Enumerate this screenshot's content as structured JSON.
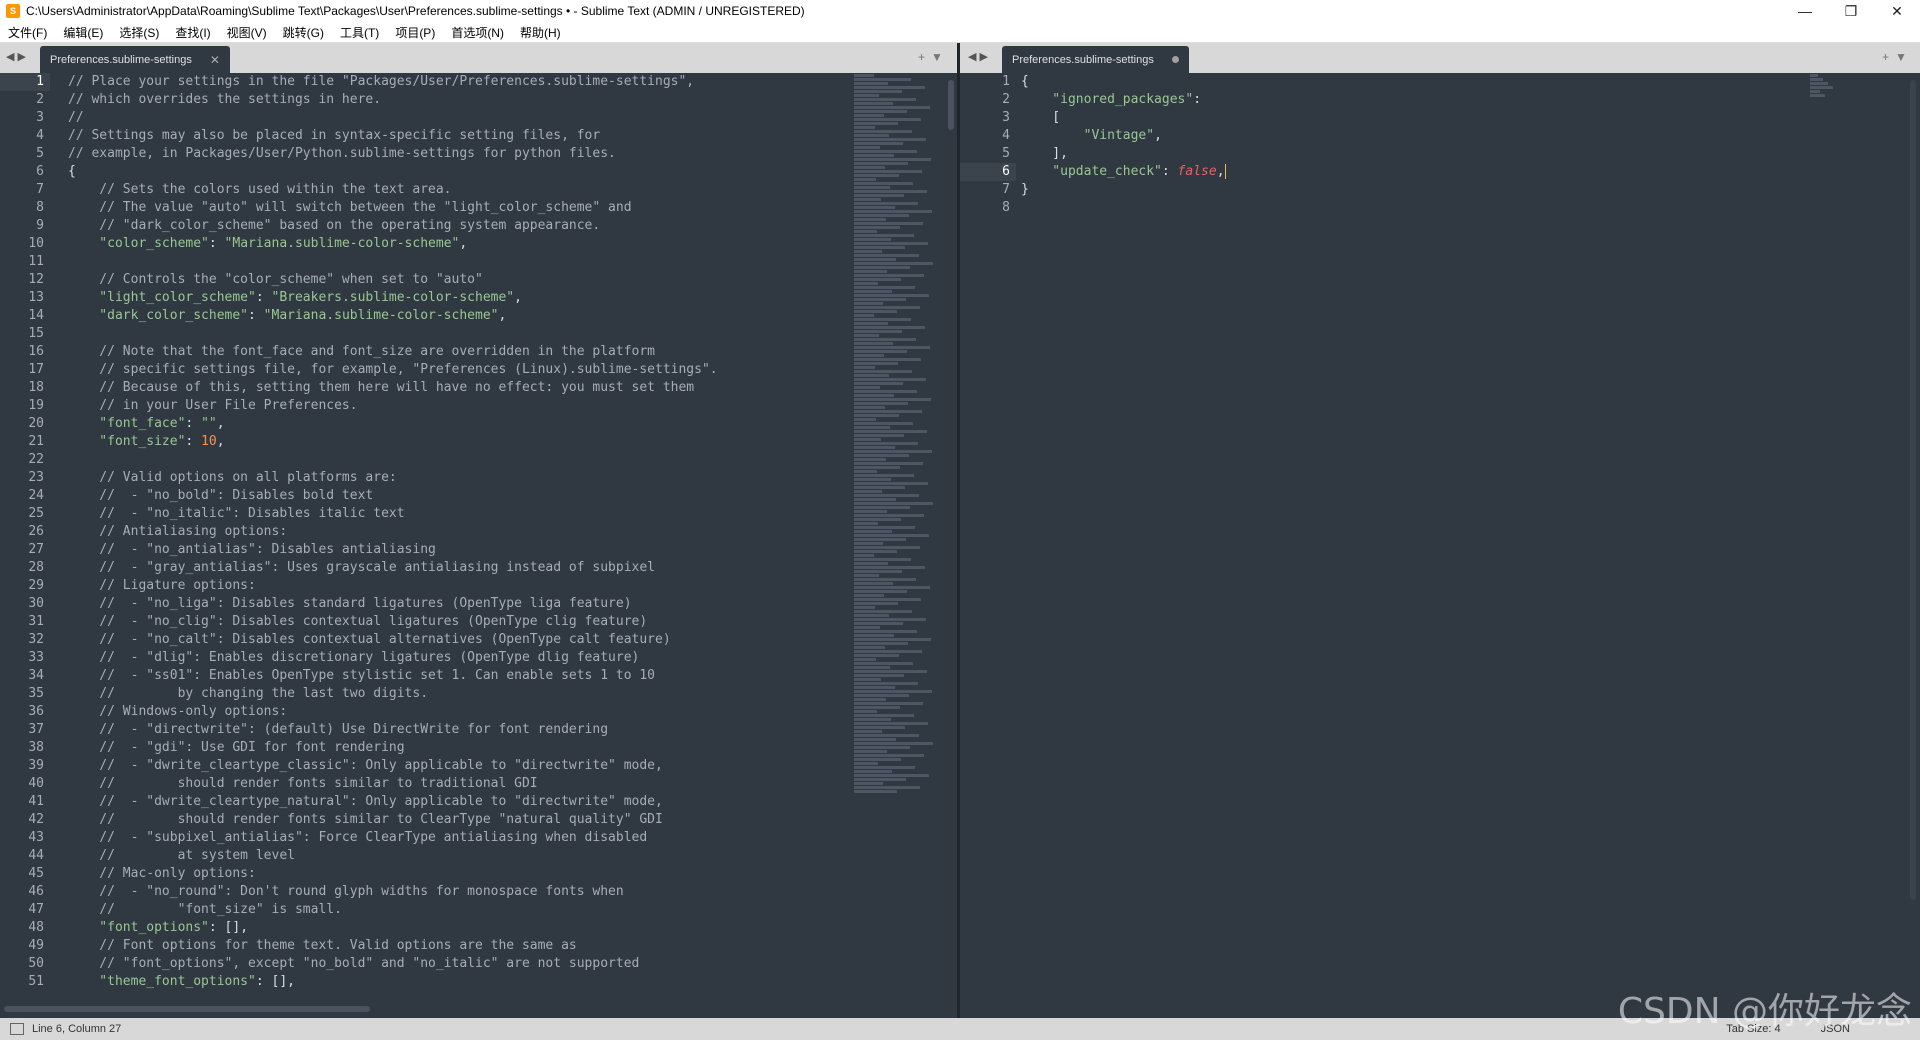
{
  "window": {
    "title": "C:\\Users\\Administrator\\AppData\\Roaming\\Sublime Text\\Packages\\User\\Preferences.sublime-settings • - Sublime Text (ADMIN / UNREGISTERED)",
    "minimize": "—",
    "restore": "❐",
    "close": "✕"
  },
  "menu": [
    "文件(F)",
    "编辑(E)",
    "选择(S)",
    "查找(I)",
    "视图(V)",
    "跳转(G)",
    "工具(T)",
    "项目(P)",
    "首选项(N)",
    "帮助(H)"
  ],
  "left_pane": {
    "tab_label": "Preferences.sublime-settings",
    "close_glyph": "✕",
    "nav_glyph": "◀▶",
    "right_glyphs": "+▼",
    "lines": [
      [
        [
          "c",
          "// Place your settings in the file \"Packages/User/Preferences.sublime-settings\","
        ]
      ],
      [
        [
          "c",
          "// which overrides the settings in here."
        ]
      ],
      [
        [
          "c",
          "//"
        ]
      ],
      [
        [
          "c",
          "// Settings may also be placed in syntax-specific setting files, for"
        ]
      ],
      [
        [
          "c",
          "// example, in Packages/User/Python.sublime-settings for python files."
        ]
      ],
      [
        [
          "p",
          "{"
        ]
      ],
      [
        [
          "c",
          "    // Sets the colors used within the text area."
        ]
      ],
      [
        [
          "c",
          "    // The value \"auto\" will switch between the \"light_color_scheme\" and"
        ]
      ],
      [
        [
          "c",
          "    // \"dark_color_scheme\" based on the operating system appearance."
        ]
      ],
      [
        [
          "s",
          "    \"color_scheme\""
        ],
        [
          "p",
          ": "
        ],
        [
          "s",
          "\"Mariana.sublime-color-scheme\""
        ],
        [
          "p",
          ","
        ]
      ],
      [
        [
          "p",
          ""
        ]
      ],
      [
        [
          "c",
          "    // Controls the \"color_scheme\" when set to \"auto\""
        ]
      ],
      [
        [
          "s",
          "    \"light_color_scheme\""
        ],
        [
          "p",
          ": "
        ],
        [
          "s",
          "\"Breakers.sublime-color-scheme\""
        ],
        [
          "p",
          ","
        ]
      ],
      [
        [
          "s",
          "    \"dark_color_scheme\""
        ],
        [
          "p",
          ": "
        ],
        [
          "s",
          "\"Mariana.sublime-color-scheme\""
        ],
        [
          "p",
          ","
        ]
      ],
      [
        [
          "p",
          ""
        ]
      ],
      [
        [
          "c",
          "    // Note that the font_face and font_size are overridden in the platform"
        ]
      ],
      [
        [
          "c",
          "    // specific settings file, for example, \"Preferences (Linux).sublime-settings\"."
        ]
      ],
      [
        [
          "c",
          "    // Because of this, setting them here will have no effect: you must set them"
        ]
      ],
      [
        [
          "c",
          "    // in your User File Preferences."
        ]
      ],
      [
        [
          "s",
          "    \"font_face\""
        ],
        [
          "p",
          ": "
        ],
        [
          "s",
          "\"\""
        ],
        [
          "p",
          ","
        ]
      ],
      [
        [
          "s",
          "    \"font_size\""
        ],
        [
          "p",
          ": "
        ],
        [
          "n",
          "10"
        ],
        [
          "p",
          ","
        ]
      ],
      [
        [
          "p",
          ""
        ]
      ],
      [
        [
          "c",
          "    // Valid options on all platforms are:"
        ]
      ],
      [
        [
          "c",
          "    //  - \"no_bold\": Disables bold text"
        ]
      ],
      [
        [
          "c",
          "    //  - \"no_italic\": Disables italic text"
        ]
      ],
      [
        [
          "c",
          "    // Antialiasing options:"
        ]
      ],
      [
        [
          "c",
          "    //  - \"no_antialias\": Disables antialiasing"
        ]
      ],
      [
        [
          "c",
          "    //  - \"gray_antialias\": Uses grayscale antialiasing instead of subpixel"
        ]
      ],
      [
        [
          "c",
          "    // Ligature options:"
        ]
      ],
      [
        [
          "c",
          "    //  - \"no_liga\": Disables standard ligatures (OpenType liga feature)"
        ]
      ],
      [
        [
          "c",
          "    //  - \"no_clig\": Disables contextual ligatures (OpenType clig feature)"
        ]
      ],
      [
        [
          "c",
          "    //  - \"no_calt\": Disables contextual alternatives (OpenType calt feature)"
        ]
      ],
      [
        [
          "c",
          "    //  - \"dlig\": Enables discretionary ligatures (OpenType dlig feature)"
        ]
      ],
      [
        [
          "c",
          "    //  - \"ss01\": Enables OpenType stylistic set 1. Can enable sets 1 to 10"
        ]
      ],
      [
        [
          "c",
          "    //        by changing the last two digits."
        ]
      ],
      [
        [
          "c",
          "    // Windows-only options:"
        ]
      ],
      [
        [
          "c",
          "    //  - \"directwrite\": (default) Use DirectWrite for font rendering"
        ]
      ],
      [
        [
          "c",
          "    //  - \"gdi\": Use GDI for font rendering"
        ]
      ],
      [
        [
          "c",
          "    //  - \"dwrite_cleartype_classic\": Only applicable to \"directwrite\" mode,"
        ]
      ],
      [
        [
          "c",
          "    //        should render fonts similar to traditional GDI"
        ]
      ],
      [
        [
          "c",
          "    //  - \"dwrite_cleartype_natural\": Only applicable to \"directwrite\" mode,"
        ]
      ],
      [
        [
          "c",
          "    //        should render fonts similar to ClearType \"natural quality\" GDI"
        ]
      ],
      [
        [
          "c",
          "    //  - \"subpixel_antialias\": Force ClearType antialiasing when disabled"
        ]
      ],
      [
        [
          "c",
          "    //        at system level"
        ]
      ],
      [
        [
          "c",
          "    // Mac-only options:"
        ]
      ],
      [
        [
          "c",
          "    //  - \"no_round\": Don't round glyph widths for monospace fonts when"
        ]
      ],
      [
        [
          "c",
          "    //        \"font_size\" is small."
        ]
      ],
      [
        [
          "s",
          "    \"font_options\""
        ],
        [
          "p",
          ": [],"
        ]
      ],
      [
        [
          "c",
          "    // Font options for theme text. Valid options are the same as"
        ]
      ],
      [
        [
          "c",
          "    // \"font_options\", except \"no_bold\" and \"no_italic\" are not supported"
        ]
      ],
      [
        [
          "s",
          "    \"theme_font_options\""
        ],
        [
          "p",
          ": [],"
        ]
      ]
    ]
  },
  "right_pane": {
    "tab_label": "Preferences.sublime-settings",
    "nav_glyph": "◀▶",
    "right_glyphs": "+▼",
    "current_line": 6,
    "lines": [
      [
        [
          "p",
          "{"
        ]
      ],
      [
        [
          "s",
          "    \"ignored_packages\""
        ],
        [
          "p",
          ":"
        ]
      ],
      [
        [
          "p",
          "    ["
        ]
      ],
      [
        [
          "s",
          "        \"Vintage\""
        ],
        [
          "p",
          ","
        ]
      ],
      [
        [
          "p",
          "    ],"
        ]
      ],
      [
        [
          "s",
          "    \"update_check\""
        ],
        [
          "p",
          ": "
        ],
        [
          "f",
          "false"
        ],
        [
          "p",
          ","
        ]
      ],
      [
        [
          "p",
          "}"
        ]
      ],
      [
        [
          "p",
          ""
        ]
      ]
    ]
  },
  "status": {
    "position": "Line 6, Column 27",
    "tab_size": "Tab Size: 4",
    "syntax": "JSON"
  },
  "watermark": "CSDN @你好龙念"
}
